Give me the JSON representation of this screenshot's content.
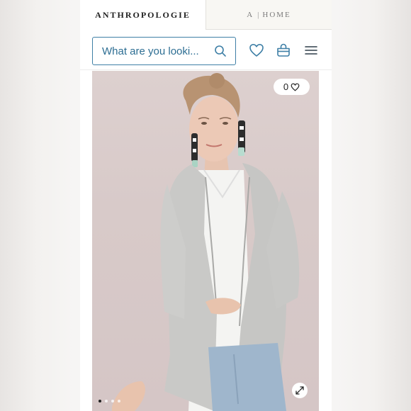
{
  "brand_tabs": {
    "primary": "ANTHROPOLOGIE",
    "secondary_prefix": "A",
    "secondary_separator": "|",
    "secondary_name": "HOME"
  },
  "header": {
    "search_placeholder": "What are you looki...",
    "icons": [
      "search-icon",
      "heart-icon",
      "shopping-bag-icon",
      "hamburger-menu-icon"
    ]
  },
  "product": {
    "wishlist_count": "0",
    "image_dots_total": 4,
    "image_dots_active": 1,
    "expand_icon": "expand-icon"
  },
  "colors": {
    "accent": "#3e7fa6",
    "brand_text": "#1f1f1f",
    "backdrop": "#d8cac9"
  }
}
